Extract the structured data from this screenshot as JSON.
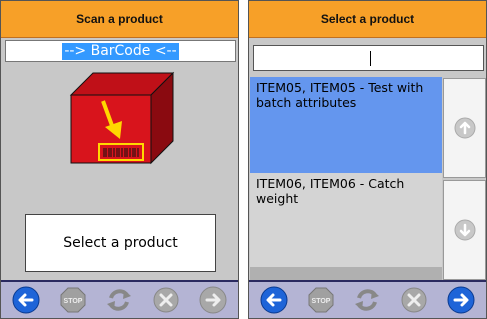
{
  "left_panel": {
    "title": "Scan a product",
    "barcode_placeholder": "--> BarCode <--",
    "select_button": "Select a product"
  },
  "right_panel": {
    "title": "Select a product",
    "search_value": "",
    "items": [
      {
        "label": "ITEM05, ITEM05 - Test with batch attributes",
        "selected": true
      },
      {
        "label": "ITEM06, ITEM06 - Catch weight",
        "selected": false
      }
    ]
  },
  "colors": {
    "header": "#f7a028",
    "selected_row": "#6496ee",
    "footer": "#b4b4d4"
  },
  "footer_icons": [
    "back-icon",
    "stop-icon",
    "refresh-icon",
    "cancel-icon",
    "forward-icon"
  ]
}
